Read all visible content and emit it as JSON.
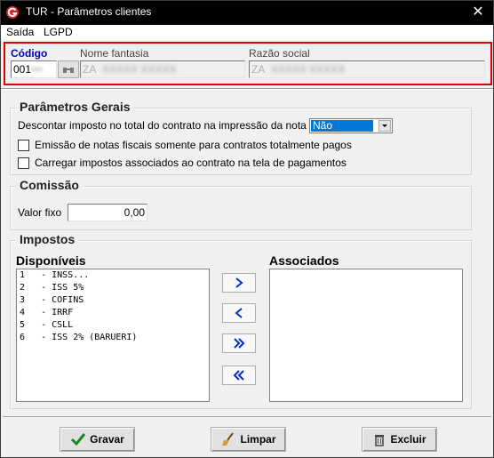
{
  "window": {
    "title": "TUR - Parâmetros clientes",
    "close_glyph": "✕"
  },
  "menu": {
    "items": [
      "Saída",
      "LGPD"
    ]
  },
  "header": {
    "codigo_label": "Código",
    "codigo_value": "001",
    "nome_fantasia_label": "Nome fantasia",
    "nome_fantasia_value": "ZA",
    "razao_social_label": "Razão social",
    "razao_social_value": "ZA",
    "lookup_icon": "binoculars-icon"
  },
  "parametros_gerais": {
    "title": "Parâmetros Gerais",
    "desconto_label": "Descontar imposto no total do contrato na impressão da nota fiscal",
    "desconto_value": "Não",
    "check_emissao_label": "Emissão de notas fiscais somente para contratos totalmente pagos",
    "check_emissao_checked": false,
    "check_carregar_label": "Carregar impostos associados ao contrato na tela de pagamentos",
    "check_carregar_checked": false
  },
  "comissao": {
    "title": "Comissão",
    "valor_fixo_label": "Valor fixo",
    "valor_fixo_value": "0,00"
  },
  "impostos": {
    "title": "Impostos",
    "disponiveis_label": "Disponíveis",
    "associados_label": "Associados",
    "disponiveis": [
      "1   - INSS...",
      "2   - ISS 5%",
      "3   - COFINS",
      "4   - IRRF",
      "5   - CSLL",
      "6   - ISS 2% (BARUERI)"
    ],
    "associados": []
  },
  "actions": {
    "gravar": "Gravar",
    "limpar": "Limpar",
    "excluir": "Excluir"
  },
  "colors": {
    "accent": "#0000c0",
    "highlight_border": "#e00000",
    "selection": "#0078d7"
  }
}
